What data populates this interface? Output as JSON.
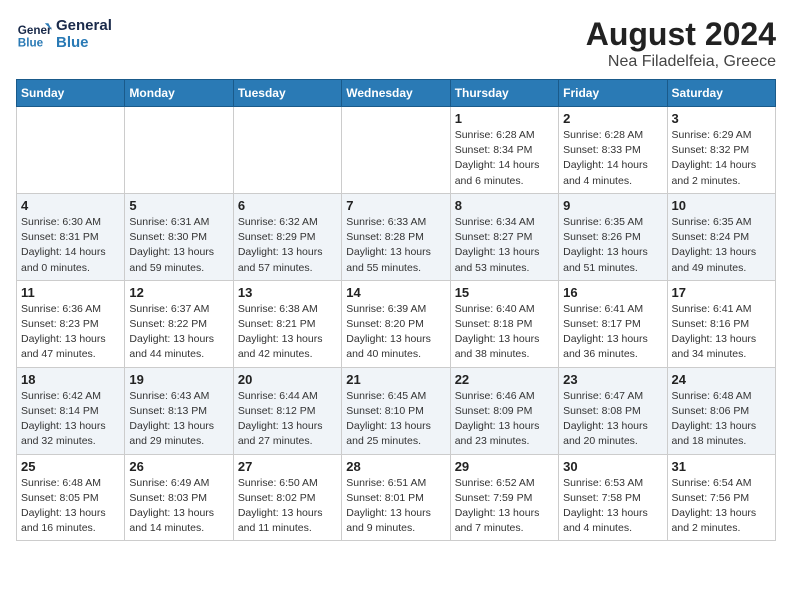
{
  "header": {
    "logo_line1": "General",
    "logo_line2": "Blue",
    "month_year": "August 2024",
    "location": "Nea Filadelfeia, Greece"
  },
  "weekdays": [
    "Sunday",
    "Monday",
    "Tuesday",
    "Wednesday",
    "Thursday",
    "Friday",
    "Saturday"
  ],
  "weeks": [
    [
      {
        "day": "",
        "info": ""
      },
      {
        "day": "",
        "info": ""
      },
      {
        "day": "",
        "info": ""
      },
      {
        "day": "",
        "info": ""
      },
      {
        "day": "1",
        "info": "Sunrise: 6:28 AM\nSunset: 8:34 PM\nDaylight: 14 hours\nand 6 minutes."
      },
      {
        "day": "2",
        "info": "Sunrise: 6:28 AM\nSunset: 8:33 PM\nDaylight: 14 hours\nand 4 minutes."
      },
      {
        "day": "3",
        "info": "Sunrise: 6:29 AM\nSunset: 8:32 PM\nDaylight: 14 hours\nand 2 minutes."
      }
    ],
    [
      {
        "day": "4",
        "info": "Sunrise: 6:30 AM\nSunset: 8:31 PM\nDaylight: 14 hours\nand 0 minutes."
      },
      {
        "day": "5",
        "info": "Sunrise: 6:31 AM\nSunset: 8:30 PM\nDaylight: 13 hours\nand 59 minutes."
      },
      {
        "day": "6",
        "info": "Sunrise: 6:32 AM\nSunset: 8:29 PM\nDaylight: 13 hours\nand 57 minutes."
      },
      {
        "day": "7",
        "info": "Sunrise: 6:33 AM\nSunset: 8:28 PM\nDaylight: 13 hours\nand 55 minutes."
      },
      {
        "day": "8",
        "info": "Sunrise: 6:34 AM\nSunset: 8:27 PM\nDaylight: 13 hours\nand 53 minutes."
      },
      {
        "day": "9",
        "info": "Sunrise: 6:35 AM\nSunset: 8:26 PM\nDaylight: 13 hours\nand 51 minutes."
      },
      {
        "day": "10",
        "info": "Sunrise: 6:35 AM\nSunset: 8:24 PM\nDaylight: 13 hours\nand 49 minutes."
      }
    ],
    [
      {
        "day": "11",
        "info": "Sunrise: 6:36 AM\nSunset: 8:23 PM\nDaylight: 13 hours\nand 47 minutes."
      },
      {
        "day": "12",
        "info": "Sunrise: 6:37 AM\nSunset: 8:22 PM\nDaylight: 13 hours\nand 44 minutes."
      },
      {
        "day": "13",
        "info": "Sunrise: 6:38 AM\nSunset: 8:21 PM\nDaylight: 13 hours\nand 42 minutes."
      },
      {
        "day": "14",
        "info": "Sunrise: 6:39 AM\nSunset: 8:20 PM\nDaylight: 13 hours\nand 40 minutes."
      },
      {
        "day": "15",
        "info": "Sunrise: 6:40 AM\nSunset: 8:18 PM\nDaylight: 13 hours\nand 38 minutes."
      },
      {
        "day": "16",
        "info": "Sunrise: 6:41 AM\nSunset: 8:17 PM\nDaylight: 13 hours\nand 36 minutes."
      },
      {
        "day": "17",
        "info": "Sunrise: 6:41 AM\nSunset: 8:16 PM\nDaylight: 13 hours\nand 34 minutes."
      }
    ],
    [
      {
        "day": "18",
        "info": "Sunrise: 6:42 AM\nSunset: 8:14 PM\nDaylight: 13 hours\nand 32 minutes."
      },
      {
        "day": "19",
        "info": "Sunrise: 6:43 AM\nSunset: 8:13 PM\nDaylight: 13 hours\nand 29 minutes."
      },
      {
        "day": "20",
        "info": "Sunrise: 6:44 AM\nSunset: 8:12 PM\nDaylight: 13 hours\nand 27 minutes."
      },
      {
        "day": "21",
        "info": "Sunrise: 6:45 AM\nSunset: 8:10 PM\nDaylight: 13 hours\nand 25 minutes."
      },
      {
        "day": "22",
        "info": "Sunrise: 6:46 AM\nSunset: 8:09 PM\nDaylight: 13 hours\nand 23 minutes."
      },
      {
        "day": "23",
        "info": "Sunrise: 6:47 AM\nSunset: 8:08 PM\nDaylight: 13 hours\nand 20 minutes."
      },
      {
        "day": "24",
        "info": "Sunrise: 6:48 AM\nSunset: 8:06 PM\nDaylight: 13 hours\nand 18 minutes."
      }
    ],
    [
      {
        "day": "25",
        "info": "Sunrise: 6:48 AM\nSunset: 8:05 PM\nDaylight: 13 hours\nand 16 minutes."
      },
      {
        "day": "26",
        "info": "Sunrise: 6:49 AM\nSunset: 8:03 PM\nDaylight: 13 hours\nand 14 minutes."
      },
      {
        "day": "27",
        "info": "Sunrise: 6:50 AM\nSunset: 8:02 PM\nDaylight: 13 hours\nand 11 minutes."
      },
      {
        "day": "28",
        "info": "Sunrise: 6:51 AM\nSunset: 8:01 PM\nDaylight: 13 hours\nand 9 minutes."
      },
      {
        "day": "29",
        "info": "Sunrise: 6:52 AM\nSunset: 7:59 PM\nDaylight: 13 hours\nand 7 minutes."
      },
      {
        "day": "30",
        "info": "Sunrise: 6:53 AM\nSunset: 7:58 PM\nDaylight: 13 hours\nand 4 minutes."
      },
      {
        "day": "31",
        "info": "Sunrise: 6:54 AM\nSunset: 7:56 PM\nDaylight: 13 hours\nand 2 minutes."
      }
    ]
  ]
}
